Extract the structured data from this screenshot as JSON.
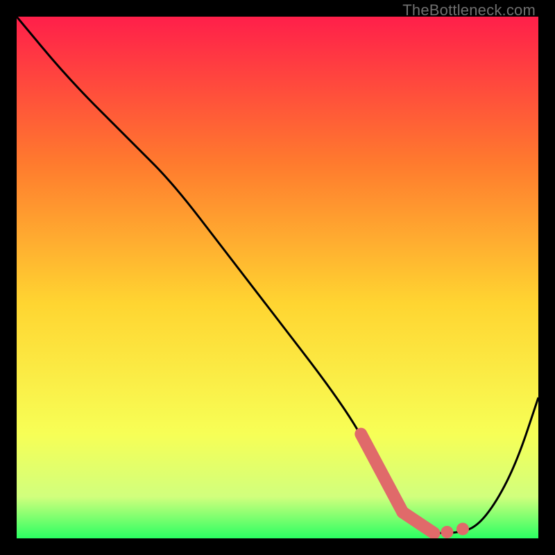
{
  "watermark": "TheBottleneck.com",
  "colors": {
    "bg": "#000000",
    "grad_top": "#ff1f4a",
    "grad_mid1": "#ff7a2e",
    "grad_mid2": "#ffd531",
    "grad_low1": "#f7ff56",
    "grad_low2": "#d1ff7d",
    "grad_bottom": "#2bff62",
    "curve": "#000000",
    "marker_fill": "#e06a6a",
    "marker_stroke": "#d43f3f"
  },
  "chart_data": {
    "type": "line",
    "title": "",
    "xlabel": "",
    "ylabel": "",
    "xlim": [
      0,
      100
    ],
    "ylim": [
      0,
      100
    ],
    "series": [
      {
        "name": "bottleneck-curve",
        "x": [
          0,
          10,
          22,
          30,
          40,
          50,
          60,
          66,
          70,
          74,
          78,
          80,
          84,
          88,
          92,
          96,
          100
        ],
        "y": [
          100,
          88,
          76,
          68,
          55,
          42,
          29,
          20,
          12,
          5,
          2,
          1,
          1,
          2,
          7,
          15,
          27
        ]
      }
    ],
    "markers": {
      "name": "highlighted-range",
      "segments": [
        {
          "x": [
            66,
            74
          ],
          "y": [
            20,
            5
          ]
        },
        {
          "x": [
            74,
            80
          ],
          "y": [
            5,
            1
          ]
        }
      ],
      "dots": [
        {
          "x": 82.5,
          "y": 1.2
        },
        {
          "x": 85.5,
          "y": 1.8
        }
      ]
    }
  }
}
